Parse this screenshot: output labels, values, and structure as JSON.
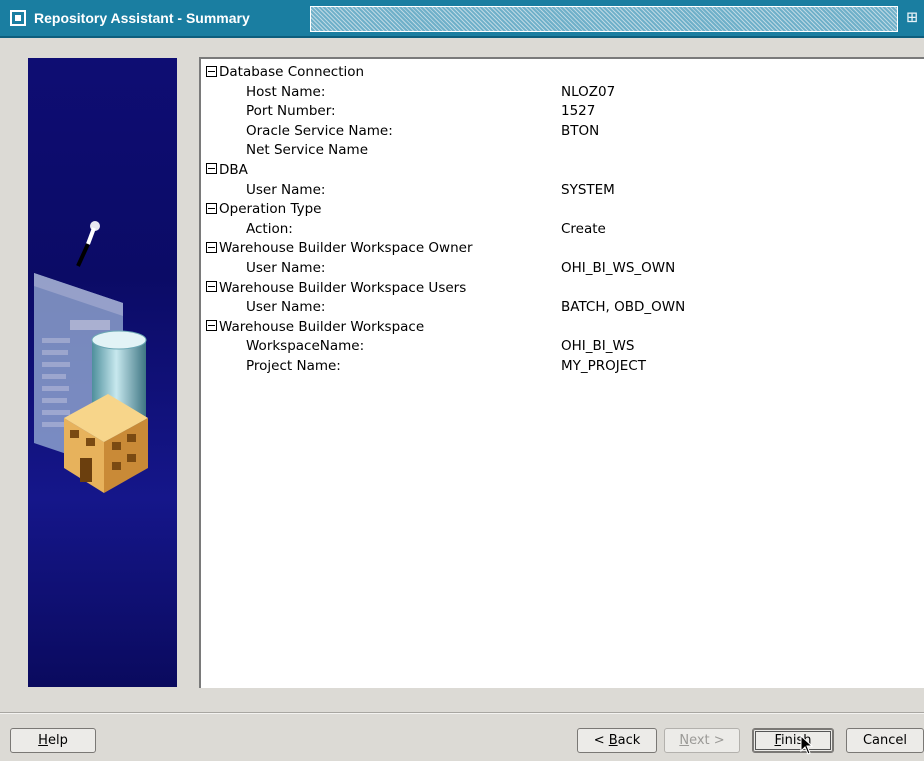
{
  "window": {
    "title": "Repository Assistant - Summary"
  },
  "summary": {
    "sections": [
      {
        "title": "Database Connection",
        "items": [
          {
            "label": "Host Name:",
            "value": "NLOZ07"
          },
          {
            "label": "Port Number:",
            "value": "1527"
          },
          {
            "label": "Oracle Service Name:",
            "value": "BTON"
          },
          {
            "label": "Net Service Name",
            "value": ""
          }
        ]
      },
      {
        "title": "DBA",
        "items": [
          {
            "label": "User Name:",
            "value": "SYSTEM"
          }
        ]
      },
      {
        "title": "Operation Type",
        "items": [
          {
            "label": "Action:",
            "value": "Create"
          }
        ]
      },
      {
        "title": "Warehouse Builder Workspace Owner",
        "items": [
          {
            "label": "User Name:",
            "value": "OHI_BI_WS_OWN"
          }
        ]
      },
      {
        "title": "Warehouse Builder Workspace Users",
        "items": [
          {
            "label": "User Name:",
            "value": "BATCH, OBD_OWN"
          }
        ]
      },
      {
        "title": "Warehouse Builder Workspace",
        "items": [
          {
            "label": "WorkspaceName:",
            "value": "OHI_BI_WS"
          },
          {
            "label": "Project Name:",
            "value": "MY_PROJECT"
          }
        ]
      }
    ]
  },
  "buttons": {
    "help": {
      "label": "Help",
      "mnemonic": "H",
      "rest": "elp"
    },
    "back": {
      "label": "< Back",
      "pre": "< ",
      "mnemonic": "B",
      "rest": "ack"
    },
    "next": {
      "label": "Next >",
      "mnemonic": "N",
      "rest": "ext >"
    },
    "finish": {
      "label": "Finish",
      "mnemonic": "F",
      "rest": "inish"
    },
    "cancel": {
      "label": "Cancel"
    }
  },
  "colors": {
    "titlebar": "#1a7ea1",
    "side_panel": "#0e0d73",
    "background": "#dcdad5"
  },
  "icons": [
    "window-menu-icon",
    "maximize-icon",
    "database-cylinder-icon",
    "building-icon",
    "magic-wand-icon",
    "mouse-pointer-icon"
  ]
}
